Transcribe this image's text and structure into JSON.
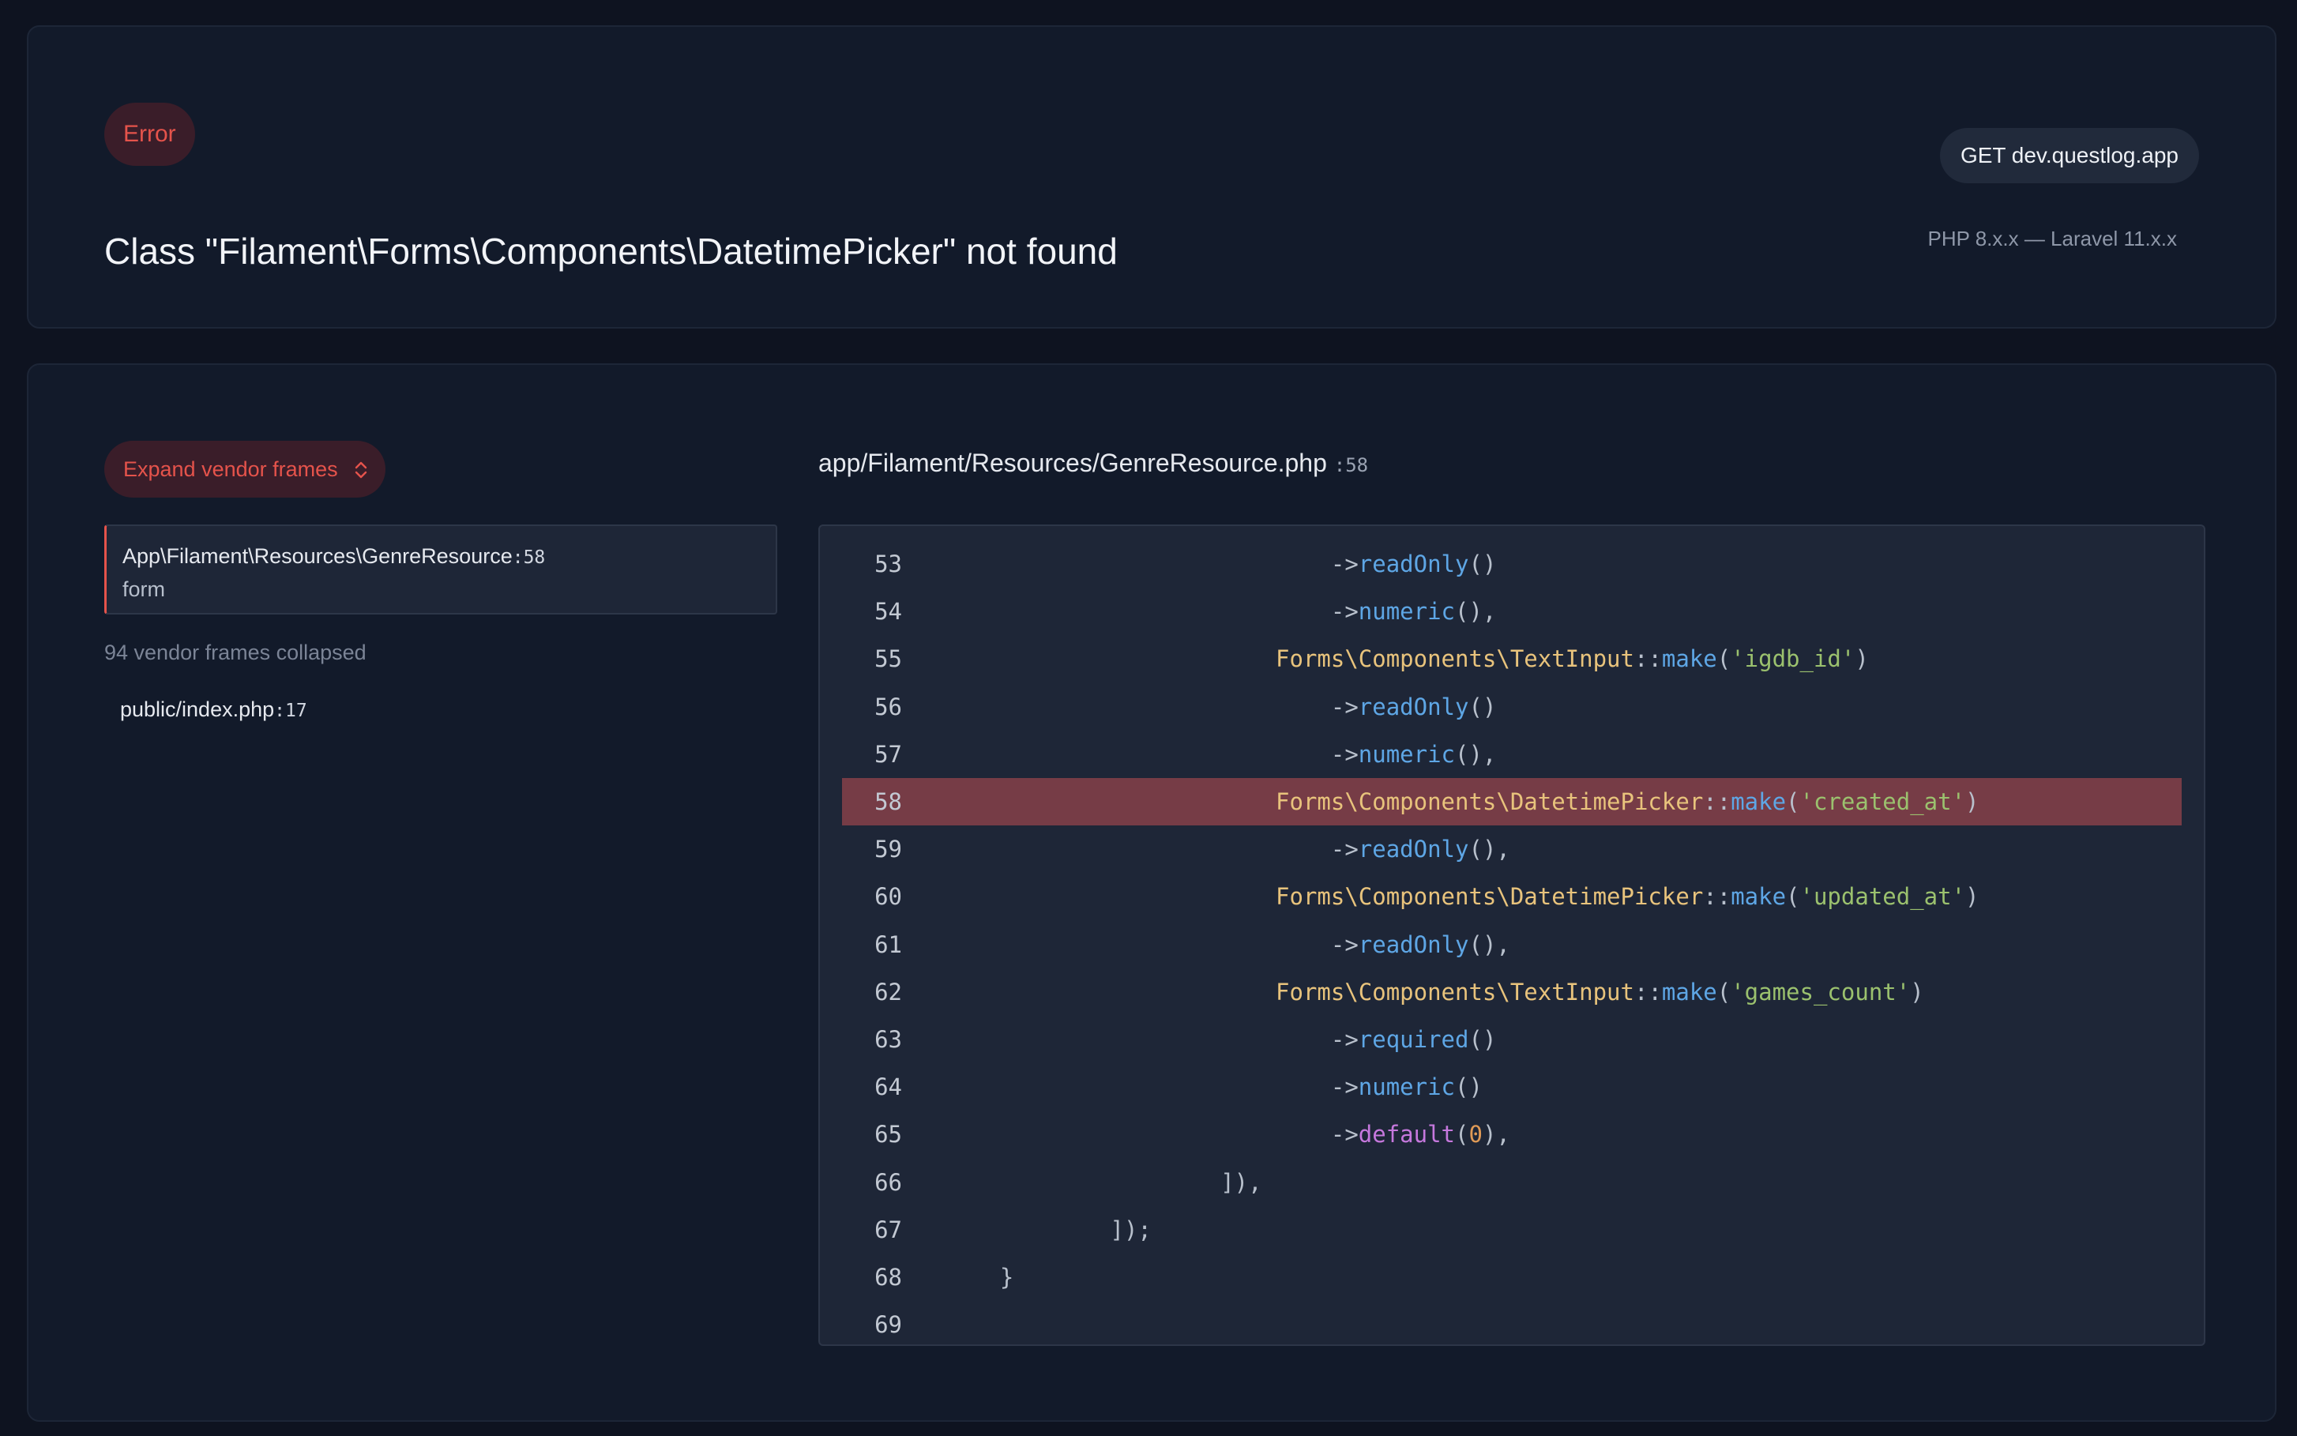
{
  "header": {
    "badge": "Error",
    "title": "Class \"Filament\\Forms\\Components\\DatetimePicker\" not found",
    "request": "GET dev.questlog.app",
    "versions": "PHP 8.x.x — Laravel 11.x.x"
  },
  "trace": {
    "expand_label": "Expand vendor frames",
    "expand_icon": "chevron-up-down-icon",
    "selected_frame": {
      "class": "App\\Filament\\Resources\\GenreResource",
      "line": ":58",
      "method": "form"
    },
    "vendor_collapsed": "94 vendor frames collapsed",
    "public_frame": {
      "file": "public/index.php",
      "line": ":17"
    }
  },
  "code": {
    "file": "app/Filament/Resources/GenreResource.php",
    "line_ref": ":58",
    "highlight_line": 58,
    "lines": [
      {
        "n": "53",
        "tokens": [
          {
            "t": "                            ->",
            "c": "p"
          },
          {
            "t": "readOnly",
            "c": "fn"
          },
          {
            "t": "()",
            "c": "p"
          }
        ]
      },
      {
        "n": "54",
        "tokens": [
          {
            "t": "                            ->",
            "c": "p"
          },
          {
            "t": "numeric",
            "c": "fn"
          },
          {
            "t": "(),",
            "c": "p"
          }
        ]
      },
      {
        "n": "55",
        "tokens": [
          {
            "t": "                        ",
            "c": "p"
          },
          {
            "t": "Forms\\Components\\TextInput",
            "c": "cls"
          },
          {
            "t": "::",
            "c": "p"
          },
          {
            "t": "make",
            "c": "fn"
          },
          {
            "t": "(",
            "c": "p"
          },
          {
            "t": "'igdb_id'",
            "c": "str"
          },
          {
            "t": ")",
            "c": "p"
          }
        ]
      },
      {
        "n": "56",
        "tokens": [
          {
            "t": "                            ->",
            "c": "p"
          },
          {
            "t": "readOnly",
            "c": "fn"
          },
          {
            "t": "()",
            "c": "p"
          }
        ]
      },
      {
        "n": "57",
        "tokens": [
          {
            "t": "                            ->",
            "c": "p"
          },
          {
            "t": "numeric",
            "c": "fn"
          },
          {
            "t": "(),",
            "c": "p"
          }
        ]
      },
      {
        "n": "58",
        "tokens": [
          {
            "t": "                        ",
            "c": "p"
          },
          {
            "t": "Forms\\Components\\DatetimePicker",
            "c": "cls"
          },
          {
            "t": "::",
            "c": "p"
          },
          {
            "t": "make",
            "c": "fn"
          },
          {
            "t": "(",
            "c": "p"
          },
          {
            "t": "'created_at'",
            "c": "str"
          },
          {
            "t": ")",
            "c": "p"
          }
        ]
      },
      {
        "n": "59",
        "tokens": [
          {
            "t": "                            ->",
            "c": "p"
          },
          {
            "t": "readOnly",
            "c": "fn"
          },
          {
            "t": "(),",
            "c": "p"
          }
        ]
      },
      {
        "n": "60",
        "tokens": [
          {
            "t": "                        ",
            "c": "p"
          },
          {
            "t": "Forms\\Components\\DatetimePicker",
            "c": "cls"
          },
          {
            "t": "::",
            "c": "p"
          },
          {
            "t": "make",
            "c": "fn"
          },
          {
            "t": "(",
            "c": "p"
          },
          {
            "t": "'updated_at'",
            "c": "str"
          },
          {
            "t": ")",
            "c": "p"
          }
        ]
      },
      {
        "n": "61",
        "tokens": [
          {
            "t": "                            ->",
            "c": "p"
          },
          {
            "t": "readOnly",
            "c": "fn"
          },
          {
            "t": "(),",
            "c": "p"
          }
        ]
      },
      {
        "n": "62",
        "tokens": [
          {
            "t": "                        ",
            "c": "p"
          },
          {
            "t": "Forms\\Components\\TextInput",
            "c": "cls"
          },
          {
            "t": "::",
            "c": "p"
          },
          {
            "t": "make",
            "c": "fn"
          },
          {
            "t": "(",
            "c": "p"
          },
          {
            "t": "'games_count'",
            "c": "str"
          },
          {
            "t": ")",
            "c": "p"
          }
        ]
      },
      {
        "n": "63",
        "tokens": [
          {
            "t": "                            ->",
            "c": "p"
          },
          {
            "t": "required",
            "c": "fn"
          },
          {
            "t": "()",
            "c": "p"
          }
        ]
      },
      {
        "n": "64",
        "tokens": [
          {
            "t": "                            ->",
            "c": "p"
          },
          {
            "t": "numeric",
            "c": "fn"
          },
          {
            "t": "()",
            "c": "p"
          }
        ]
      },
      {
        "n": "65",
        "tokens": [
          {
            "t": "                            ->",
            "c": "p"
          },
          {
            "t": "default",
            "c": "kw"
          },
          {
            "t": "(",
            "c": "p"
          },
          {
            "t": "0",
            "c": "num"
          },
          {
            "t": "),",
            "c": "p"
          }
        ]
      },
      {
        "n": "66",
        "tokens": [
          {
            "t": "                    ]),",
            "c": "p"
          }
        ]
      },
      {
        "n": "67",
        "tokens": [
          {
            "t": "            ]);",
            "c": "p"
          }
        ]
      },
      {
        "n": "68",
        "tokens": [
          {
            "t": "    }",
            "c": "p"
          }
        ]
      },
      {
        "n": "69",
        "tokens": []
      }
    ]
  },
  "colors": {
    "background": "#0e1320",
    "card": "#121a2a",
    "accent_red": "#e5534b",
    "highlight_row": "#763c46",
    "class_token": "#e8c37c",
    "function_token": "#5ea6e5",
    "string_token": "#9bc16e",
    "keyword_token": "#c678dd",
    "number_token": "#e09a56"
  }
}
